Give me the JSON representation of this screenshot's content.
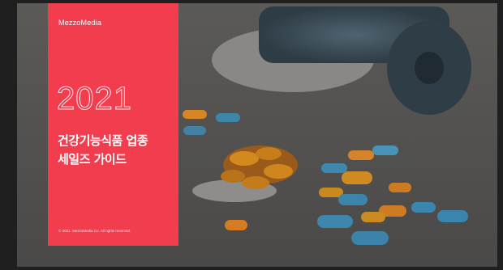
{
  "brand": "MezzoMedia",
  "cover": {
    "year": "2021",
    "title_line1": "건강기능식품 업종",
    "title_line2": "세일즈 가이드",
    "copyright": "© 2021. MezzoMedia Co. All rights reserved."
  },
  "colors": {
    "panel": "#f23d4f",
    "background": "#1f1f1f"
  },
  "image": "supplement-pills-and-dumbbell-photo"
}
